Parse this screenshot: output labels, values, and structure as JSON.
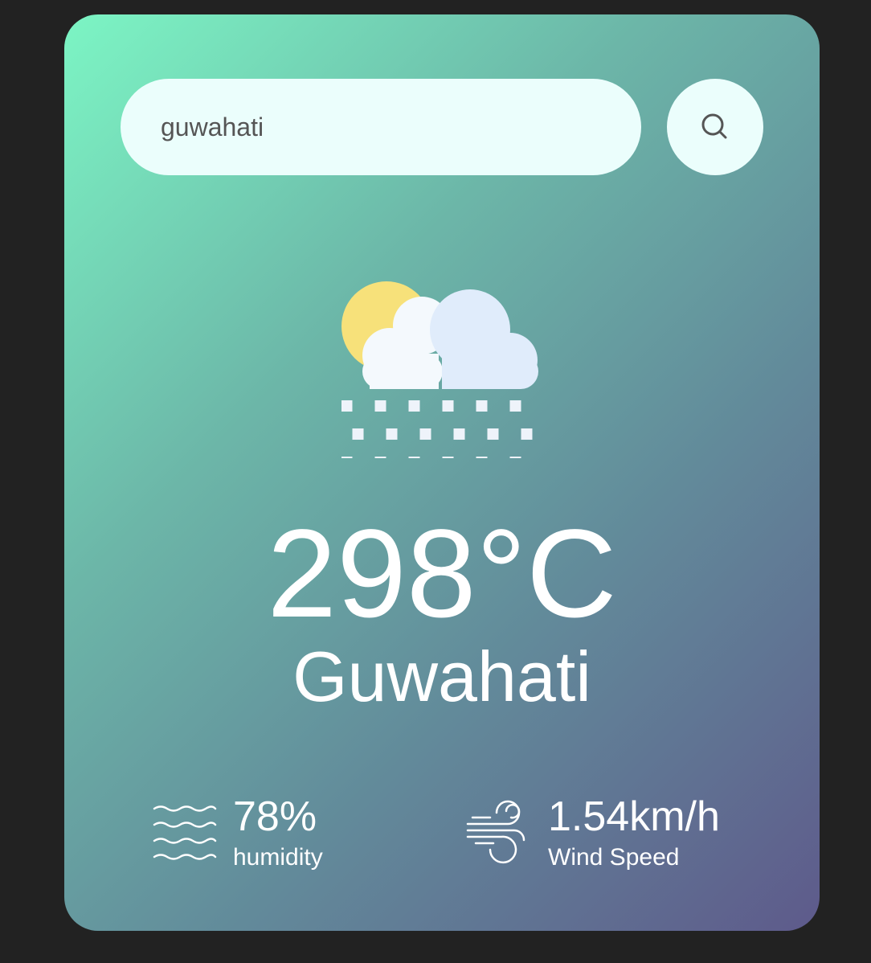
{
  "search": {
    "value": "guwahati"
  },
  "icons": {
    "search": "search-icon",
    "weather": "rain-cloud-sun-icon",
    "humidity": "humidity-waves-icon",
    "wind": "wind-icon"
  },
  "colors": {
    "background": "#222222",
    "card_gradient_start": "#7cf5c4",
    "card_gradient_end": "#5e5a8b",
    "input_background": "#ebfefc",
    "text": "#ffffff"
  },
  "weather": {
    "temperature": "298°C",
    "city": "Guwahati"
  },
  "details": {
    "humidity": {
      "value": "78%",
      "label": "humidity"
    },
    "wind": {
      "value": "1.54km/h",
      "label": "Wind Speed"
    }
  }
}
